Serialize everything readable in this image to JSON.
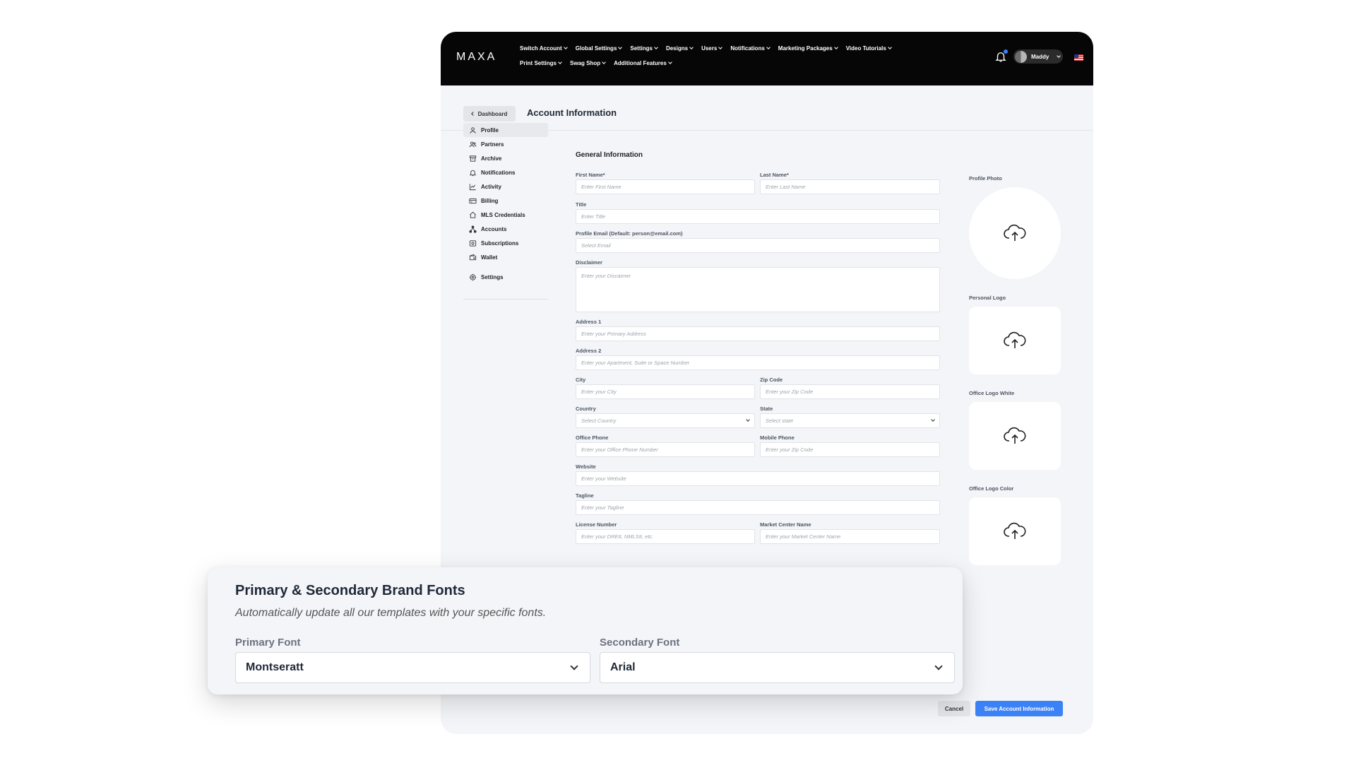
{
  "header": {
    "logo": "MAXA",
    "nav_row1": [
      "Switch Account",
      "Global Settings",
      "Settings",
      "Designs",
      "Users",
      "Notifications",
      "Marketing Packages",
      "Video Tutorials"
    ],
    "nav_row2": [
      "Print Settings",
      "Swag Shop",
      "Additional Features"
    ],
    "user_name": "Maddy"
  },
  "breadcrumb": {
    "back_label": "Dashboard"
  },
  "page": {
    "title": "Account Information"
  },
  "sidebar": {
    "items": [
      {
        "label": "Profile",
        "icon": "user-icon"
      },
      {
        "label": "Partners",
        "icon": "users-icon"
      },
      {
        "label": "Archive",
        "icon": "archive-icon"
      },
      {
        "label": "Notifications",
        "icon": "bell-icon"
      },
      {
        "label": "Activity",
        "icon": "chart-icon"
      },
      {
        "label": "Billing",
        "icon": "card-icon"
      },
      {
        "label": "MLS Credentials",
        "icon": "home-icon"
      },
      {
        "label": "Accounts",
        "icon": "network-icon"
      },
      {
        "label": "Subscriptions",
        "icon": "subscription-icon"
      },
      {
        "label": "Wallet",
        "icon": "wallet-icon"
      },
      {
        "label": "Settings",
        "icon": "gear-icon"
      }
    ]
  },
  "form": {
    "section_title": "General Information",
    "first_name": {
      "label": "First Name*",
      "placeholder": "Enter First Name"
    },
    "last_name": {
      "label": "Last Name*",
      "placeholder": "Enter Last Name"
    },
    "title": {
      "label": "Title",
      "placeholder": "Enter Title"
    },
    "email": {
      "label": "Profile Email (Default: person@email.com)",
      "placeholder": "Select Email"
    },
    "disclaimer": {
      "label": "Disclaimer",
      "placeholder": "Enter your Discaimer"
    },
    "address1": {
      "label": "Address 1",
      "placeholder": "Enter your Primary Address"
    },
    "address2": {
      "label": "Address 2",
      "placeholder": "Enter your Apartment, Suite or Space Number"
    },
    "city": {
      "label": "City",
      "placeholder": "Enter your City"
    },
    "zip": {
      "label": "Zip Code",
      "placeholder": "Enter your Zip Code"
    },
    "country": {
      "label": "Country",
      "placeholder": "Select Country"
    },
    "state": {
      "label": "State",
      "placeholder": "Select state"
    },
    "office_phone": {
      "label": "Office Phone",
      "placeholder": "Enter your Office Phone Number"
    },
    "mobile_phone": {
      "label": "Mobile Phone",
      "placeholder": "Enter your Zip Code"
    },
    "website": {
      "label": "Website",
      "placeholder": "Enter your Website"
    },
    "tagline": {
      "label": "Tagline",
      "placeholder": "Enter your Tagline"
    },
    "license": {
      "label": "License Number",
      "placeholder": "Enter your DRE#, NMLS#, etc."
    },
    "market_center": {
      "label": "Market Center Name",
      "placeholder": "Enter your Market Center Name"
    }
  },
  "uploads": {
    "profile_photo": "Profile Photo",
    "personal_logo": "Personal Logo",
    "office_logo_white": "Office Logo White",
    "office_logo_color": "Office Logo Color"
  },
  "actions": {
    "cancel": "Cancel",
    "save": "Save Account Information"
  },
  "font_card": {
    "title": "Primary & Secondary Brand Fonts",
    "subtitle": "Automatically update all our templates with your specific fonts.",
    "primary_label": "Primary Font",
    "primary_value": "Montseratt",
    "secondary_label": "Secondary Font",
    "secondary_value": "Arial"
  },
  "colors": {
    "accent": "#3b82f6",
    "topbar": "#060606",
    "panel": "#f4f5f8"
  }
}
